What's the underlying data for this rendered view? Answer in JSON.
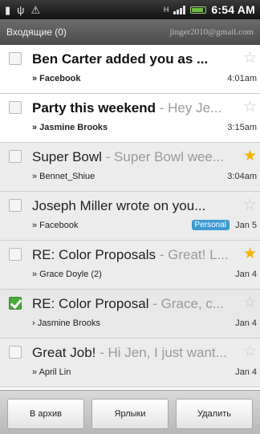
{
  "status_bar": {
    "time": "6:54 AM",
    "icons": [
      "notification-icon",
      "usb-icon",
      "warning-icon",
      "network-icon",
      "signal-icon",
      "battery-icon"
    ],
    "network_type": "H",
    "battery_color": "#6dbb3a"
  },
  "header": {
    "folder": "Входящие (0)",
    "account": "jinger2010@gmail.com"
  },
  "messages": [
    {
      "subject": "Ben Carter added you as ...",
      "snippet": "",
      "sender": "» Facebook",
      "time": "4:01am",
      "starred": false,
      "unread": true,
      "checked": false,
      "tag": ""
    },
    {
      "subject": "Party this weekend",
      "snippet": " - Hey Je...",
      "sender": "» Jasmine Brooks",
      "time": "3:15am",
      "starred": false,
      "unread": true,
      "checked": false,
      "tag": ""
    },
    {
      "subject": "Super Bowl",
      "snippet": " - Super Bowl wee...",
      "sender": "» Bennet_Shiue",
      "time": "3:04am",
      "starred": true,
      "unread": false,
      "checked": false,
      "tag": ""
    },
    {
      "subject": "Joseph Miller wrote on you...",
      "snippet": "",
      "sender": "» Facebook",
      "time": "Jan 5",
      "starred": false,
      "unread": false,
      "checked": false,
      "tag": "Personal"
    },
    {
      "subject": "RE: Color Proposals",
      "snippet": " - Great! L...",
      "sender": "» Grace Doyle (2)",
      "time": "Jan 4",
      "starred": true,
      "unread": false,
      "checked": false,
      "tag": ""
    },
    {
      "subject": "RE: Color Proposal",
      "snippet": " - Grace, c...",
      "sender": "› Jasmine Brooks",
      "time": "Jan 4",
      "starred": false,
      "unread": false,
      "checked": true,
      "tag": ""
    },
    {
      "subject": "Great Job!",
      "snippet": " - Hi Jen, I just want...",
      "sender": "» April Lin",
      "time": "Jan 4",
      "starred": false,
      "unread": false,
      "checked": false,
      "tag": ""
    }
  ],
  "toolbar": {
    "archive_label": "В архив",
    "labels_label": "Ярлыки",
    "delete_label": "Удалить"
  },
  "colors": {
    "star_on": "#f4b400",
    "checkbox_checked": "#49a83a",
    "tag_bg": "#3f9ad4"
  }
}
